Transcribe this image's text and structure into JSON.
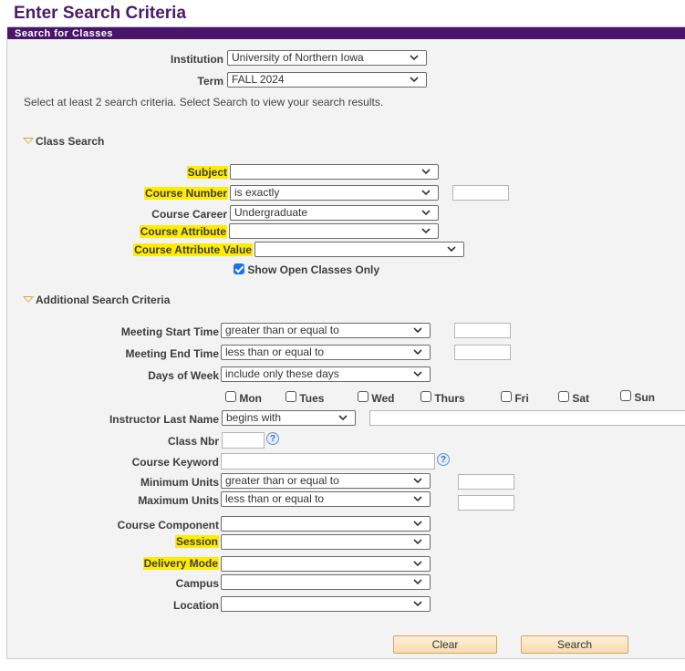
{
  "page": {
    "title": "Enter Search Criteria"
  },
  "panel": {
    "header": "Search for Classes"
  },
  "top": {
    "institution": {
      "label": "Institution",
      "value": "University of Northern Iowa"
    },
    "term": {
      "label": "Term",
      "value": "FALL 2024"
    },
    "instructions": "Select at least 2 search criteria. Select Search to view your search results."
  },
  "class_search": {
    "title": "Class Search",
    "subject": {
      "label": "Subject",
      "value": ""
    },
    "course_number": {
      "label": "Course Number",
      "operator": "is exactly",
      "value": ""
    },
    "course_career": {
      "label": "Course Career",
      "value": "Undergraduate"
    },
    "course_attribute": {
      "label": "Course Attribute",
      "value": ""
    },
    "course_attribute_value": {
      "label": "Course Attribute Value",
      "value": ""
    },
    "show_open": {
      "label": "Show Open Classes Only",
      "checked": true
    }
  },
  "additional": {
    "title": "Additional Search Criteria",
    "meeting_start": {
      "label": "Meeting Start Time",
      "operator": "greater than or equal to",
      "value": ""
    },
    "meeting_end": {
      "label": "Meeting End Time",
      "operator": "less than or equal to",
      "value": ""
    },
    "days_of_week": {
      "label": "Days of Week",
      "operator": "include only these days"
    },
    "days": [
      {
        "label": "Mon",
        "checked": false
      },
      {
        "label": "Tues",
        "checked": false
      },
      {
        "label": "Wed",
        "checked": false
      },
      {
        "label": "Thurs",
        "checked": false
      },
      {
        "label": "Fri",
        "checked": false
      },
      {
        "label": "Sat",
        "checked": false
      },
      {
        "label": "Sun",
        "checked": false
      }
    ],
    "instructor": {
      "label": "Instructor Last Name",
      "operator": "begins with",
      "value": ""
    },
    "class_nbr": {
      "label": "Class Nbr",
      "value": ""
    },
    "course_keyword": {
      "label": "Course Keyword",
      "value": ""
    },
    "min_units": {
      "label": "Minimum Units",
      "operator": "greater than or equal to",
      "value": ""
    },
    "max_units": {
      "label": "Maximum Units",
      "operator": "less than or equal to",
      "value": ""
    },
    "course_component": {
      "label": "Course Component",
      "value": ""
    },
    "session": {
      "label": "Session",
      "value": ""
    },
    "delivery_mode": {
      "label": "Delivery Mode",
      "value": ""
    },
    "campus": {
      "label": "Campus",
      "value": ""
    },
    "location": {
      "label": "Location",
      "value": ""
    }
  },
  "buttons": {
    "clear": "Clear",
    "search": "Search"
  },
  "icons": {
    "help": "?"
  },
  "colors": {
    "brand": "#4b146b",
    "highlight": "#ffec00",
    "button": "#f7dcb0"
  }
}
